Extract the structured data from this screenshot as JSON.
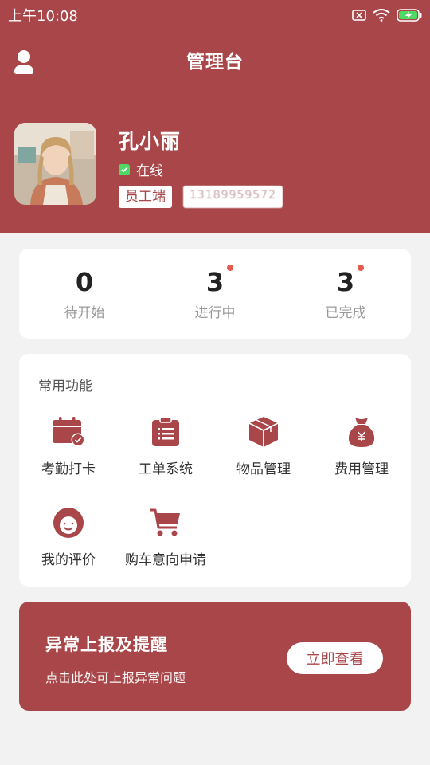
{
  "status_bar": {
    "time": "上午10:08"
  },
  "header": {
    "title": "管理台"
  },
  "profile": {
    "name": "孔小丽",
    "status": "在线",
    "role": "员工端",
    "phone": "13189959572"
  },
  "stats": [
    {
      "value": "0",
      "label": "待开始",
      "has_dot": false
    },
    {
      "value": "3",
      "label": "进行中",
      "has_dot": true
    },
    {
      "value": "3",
      "label": "已完成",
      "has_dot": true
    }
  ],
  "functions": {
    "title": "常用功能",
    "items": [
      {
        "label": "考勤打卡",
        "icon": "calendar-check-icon"
      },
      {
        "label": "工单系统",
        "icon": "clipboard-icon"
      },
      {
        "label": "物品管理",
        "icon": "box-icon"
      },
      {
        "label": "费用管理",
        "icon": "money-bag-icon"
      },
      {
        "label": "我的评价",
        "icon": "smile-face-icon"
      },
      {
        "label": "购车意向申请",
        "icon": "cart-icon"
      }
    ]
  },
  "report": {
    "title": "异常上报及提醒",
    "subtitle": "点击此处可上报异常问题",
    "button": "立即查看"
  },
  "colors": {
    "primary": "#a84649",
    "online": "#4cd964",
    "dot": "#e55b4d",
    "background": "#f2f2f2"
  }
}
